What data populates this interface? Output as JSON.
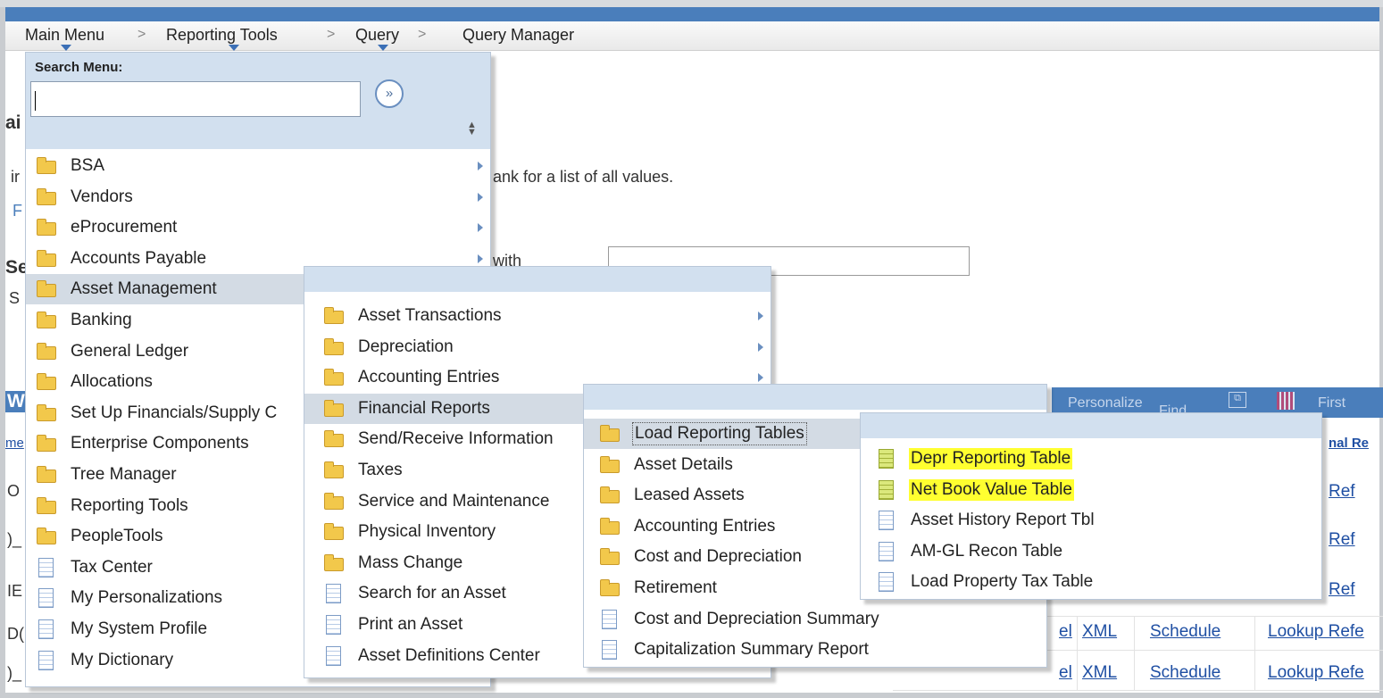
{
  "breadcrumb": {
    "items": [
      "Main Menu",
      "Reporting Tools",
      "Query",
      "Query Manager"
    ],
    "separator": ">"
  },
  "search_menu": {
    "label": "Search Menu:",
    "input_value": "",
    "go_symbol": "»"
  },
  "background_page": {
    "hint_text": "ank for a list of all values.",
    "criteria_text": "with",
    "left_fragments": [
      "ai",
      "ir",
      "F",
      "Se",
      "S",
      "W",
      "me",
      "O",
      ")_",
      "IE",
      "D(",
      ")_"
    ],
    "grid_header": {
      "personalize": "Personalize",
      "find": "Find",
      "first": "First"
    },
    "col_header_fragment": "nal Re",
    "row_links": [
      {
        "excel": "el",
        "xml": "XML",
        "schedule": "Schedule",
        "lookup": "Lookup Refe"
      },
      {
        "excel": "el",
        "xml": "XML",
        "schedule": "Schedule",
        "lookup": "Lookup Refe"
      }
    ],
    "right_fragments": [
      "Ref",
      "Ref",
      "Ref"
    ]
  },
  "menu_level1": {
    "items": [
      {
        "label": "BSA",
        "icon": "folder-icon",
        "submenu": true
      },
      {
        "label": "Vendors",
        "icon": "folder-icon",
        "submenu": true
      },
      {
        "label": "eProcurement",
        "icon": "folder-icon",
        "submenu": true
      },
      {
        "label": "Accounts Payable",
        "icon": "folder-icon",
        "submenu": true
      },
      {
        "label": "Asset Management",
        "icon": "folder-icon",
        "submenu": true,
        "selected": true
      },
      {
        "label": "Banking",
        "icon": "folder-icon"
      },
      {
        "label": "General Ledger",
        "icon": "folder-icon"
      },
      {
        "label": "Allocations",
        "icon": "folder-icon"
      },
      {
        "label": "Set Up Financials/Supply C",
        "icon": "folder-icon"
      },
      {
        "label": "Enterprise Components",
        "icon": "folder-icon"
      },
      {
        "label": "Tree Manager",
        "icon": "folder-icon"
      },
      {
        "label": "Reporting Tools",
        "icon": "folder-icon"
      },
      {
        "label": "PeopleTools",
        "icon": "folder-icon"
      },
      {
        "label": "Tax Center",
        "icon": "document-icon"
      },
      {
        "label": "My Personalizations",
        "icon": "document-icon"
      },
      {
        "label": "My System Profile",
        "icon": "document-icon"
      },
      {
        "label": "My Dictionary",
        "icon": "document-icon"
      }
    ]
  },
  "menu_level2": {
    "items": [
      {
        "label": "Asset Transactions",
        "icon": "folder-icon",
        "submenu": true
      },
      {
        "label": "Depreciation",
        "icon": "folder-icon",
        "submenu": true
      },
      {
        "label": "Accounting Entries",
        "icon": "folder-icon",
        "submenu": true
      },
      {
        "label": "Financial Reports",
        "icon": "folder-icon",
        "selected": true
      },
      {
        "label": "Send/Receive Information",
        "icon": "folder-icon"
      },
      {
        "label": "Taxes",
        "icon": "folder-icon"
      },
      {
        "label": "Service and Maintenance",
        "icon": "folder-icon"
      },
      {
        "label": "Physical Inventory",
        "icon": "folder-icon"
      },
      {
        "label": "Mass Change",
        "icon": "folder-icon"
      },
      {
        "label": "Search for an Asset",
        "icon": "document-icon"
      },
      {
        "label": "Print an Asset",
        "icon": "document-icon"
      },
      {
        "label": "Asset Definitions Center",
        "icon": "document-icon"
      }
    ]
  },
  "menu_level3": {
    "items": [
      {
        "label": "Load Reporting Tables",
        "icon": "folder-icon",
        "selected": true,
        "focused": true
      },
      {
        "label": "Asset Details",
        "icon": "folder-icon"
      },
      {
        "label": "Leased Assets",
        "icon": "folder-icon"
      },
      {
        "label": "Accounting Entries",
        "icon": "folder-icon"
      },
      {
        "label": "Cost and Depreciation",
        "icon": "folder-icon"
      },
      {
        "label": "Retirement",
        "icon": "folder-icon"
      },
      {
        "label": "Cost and Depreciation Summary",
        "icon": "document-icon"
      },
      {
        "label": "Capitalization Summary Report",
        "icon": "document-icon"
      }
    ]
  },
  "menu_level4": {
    "items": [
      {
        "label": "Depr Reporting Table",
        "icon": "document-green-icon",
        "highlighted": true
      },
      {
        "label": "Net Book Value Table",
        "icon": "document-green-icon",
        "highlighted": true
      },
      {
        "label": "Asset History Report Tbl",
        "icon": "document-icon"
      },
      {
        "label": "AM-GL Recon Table",
        "icon": "document-icon"
      },
      {
        "label": "Load Property Tax Table",
        "icon": "document-icon"
      }
    ]
  },
  "colors": {
    "brand_blue": "#4a7ebb",
    "menu_header": "#d2e0ef",
    "selected_row": "#d3dbe4",
    "highlight": "#ffff30",
    "link": "#1f4fa3"
  }
}
